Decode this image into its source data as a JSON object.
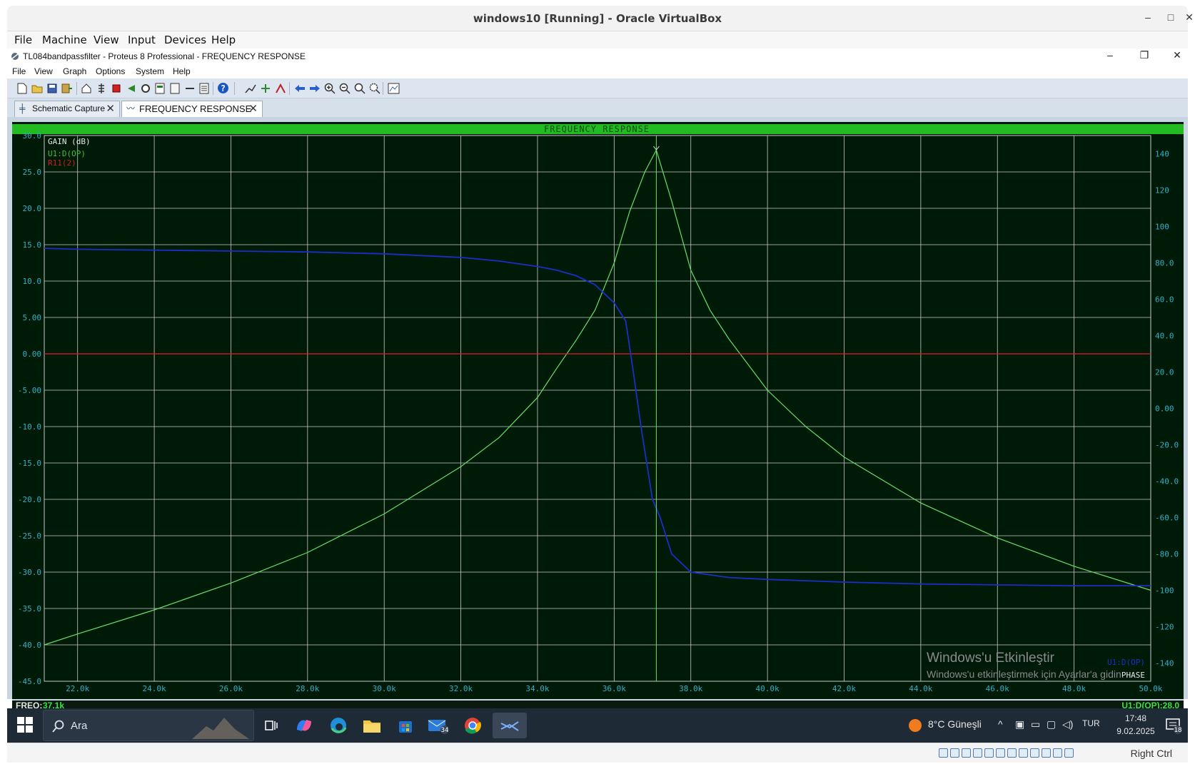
{
  "vbox": {
    "title": "windows10 [Running] - Oracle VirtualBox",
    "menu": [
      "File",
      "Machine",
      "View",
      "Input",
      "Devices",
      "Help"
    ],
    "status_text": "Right Ctrl"
  },
  "proteus": {
    "title": "TL084bandpassfilter - Proteus 8 Professional - FREQUENCY RESPONSE",
    "menu": [
      "File",
      "View",
      "Graph",
      "Options",
      "System",
      "Help"
    ],
    "tabs": [
      {
        "label": "Schematic Capture"
      },
      {
        "label": "FREQUENCY RESPONSE"
      }
    ]
  },
  "graph": {
    "title": "FREQUENCY  RESPONSE",
    "left_axis_label": "GAIN (dB)",
    "trace_labels": [
      "U1:D(OP)",
      "R11(2)"
    ],
    "right_axis_label": "PHASE",
    "right_trace_label": "U1:D(OP)",
    "cursor_readout": {
      "freq_label": "FREQ:",
      "freq_value": "37.1k",
      "value": "U1:D(OP):28.0"
    },
    "watermark": {
      "line1": "Windows'u Etkinleştir",
      "line2": "Windows'u etkinleştirmek için Ayarlar'a gidin."
    }
  },
  "chart_data": {
    "type": "line",
    "title": "FREQUENCY  RESPONSE",
    "xlabel": "",
    "x_ticks": [
      "22.0k",
      "24.0k",
      "26.0k",
      "28.0k",
      "30.0k",
      "32.0k",
      "34.0k",
      "36.0k",
      "38.0k",
      "40.0k",
      "42.0k",
      "44.0k",
      "46.0k",
      "48.0k",
      "50.0k"
    ],
    "xlim": [
      21130,
      50000
    ],
    "y_left": {
      "label": "GAIN (dB)",
      "ylim": [
        -45,
        30
      ],
      "ticks": [
        "30.0",
        "25.0",
        "20.0",
        "15.0",
        "10.0",
        "5.00",
        "0.00",
        "-5.00",
        "-10.0",
        "-15.0",
        "-20.0",
        "-25.0",
        "-30.0",
        "-35.0",
        "-40.0",
        "-45.0"
      ]
    },
    "y_right": {
      "label": "PHASE",
      "ylim": [
        -150,
        150
      ],
      "ticks": [
        "140",
        "120",
        "100",
        "80.0",
        "60.0",
        "40.0",
        "20.0",
        "0.00",
        "-20.0",
        "-40.0",
        "-60.0",
        "-80.0",
        "-100",
        "-120",
        "-140"
      ]
    },
    "grid": true,
    "cursor_x": 37100,
    "series": [
      {
        "name": "U1:D(OP)",
        "axis": "left",
        "color": "#66e066",
        "x": [
          21130,
          22000,
          24000,
          26000,
          28000,
          30000,
          32000,
          33000,
          34000,
          34500,
          35000,
          35500,
          36000,
          36400,
          36800,
          37100,
          37500,
          38000,
          38500,
          39000,
          40000,
          41000,
          42000,
          44000,
          46000,
          48000,
          50000
        ],
        "y": [
          -40.0,
          -38.5,
          -35.2,
          -31.5,
          -27.3,
          -22.0,
          -15.5,
          -11.5,
          -6.0,
          -2.0,
          1.8,
          6.0,
          12.5,
          19.5,
          25.0,
          28.0,
          21.0,
          11.5,
          6.0,
          2.0,
          -5.0,
          -10.0,
          -14.2,
          -20.5,
          -25.3,
          -29.2,
          -32.5
        ]
      },
      {
        "name": "R11(2)",
        "axis": "left",
        "color": "#e02020",
        "x": [
          21130,
          50000
        ],
        "y": [
          0.0,
          0.0
        ]
      },
      {
        "name": "U1:D(OP)",
        "axis": "right",
        "color": "#1830c8",
        "x": [
          21130,
          22000,
          24000,
          26000,
          28000,
          30000,
          32000,
          33000,
          34000,
          34500,
          35000,
          35500,
          36000,
          36300,
          36500,
          36700,
          37000,
          37200,
          37500,
          38000,
          39000,
          40000,
          42000,
          44000,
          46000,
          48000,
          50000
        ],
        "y": [
          88,
          87.5,
          87,
          86.5,
          86,
          85,
          83,
          81,
          78,
          76,
          73,
          68,
          58,
          48,
          20,
          -10,
          -50,
          -60,
          -80,
          -90,
          -93,
          -94,
          -95.5,
          -96.5,
          -97,
          -97.5,
          -97.5
        ]
      }
    ]
  }
}
